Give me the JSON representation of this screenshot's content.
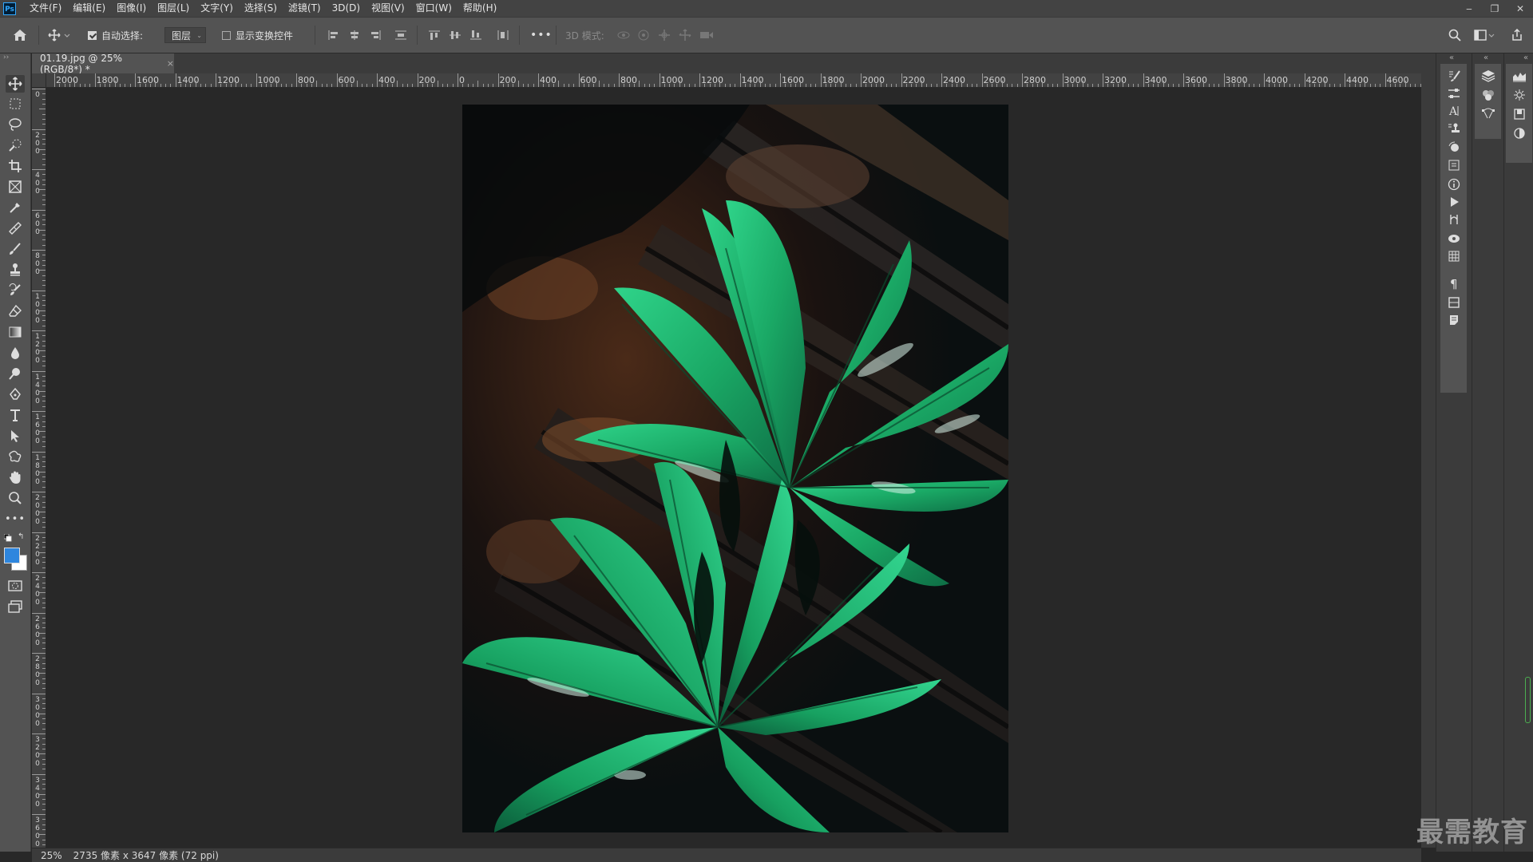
{
  "app": {
    "logo_text": "Ps"
  },
  "menu": {
    "items": [
      "文件(F)",
      "编辑(E)",
      "图像(I)",
      "图层(L)",
      "文字(Y)",
      "选择(S)",
      "滤镜(T)",
      "3D(D)",
      "视图(V)",
      "窗口(W)",
      "帮助(H)"
    ]
  },
  "window_controls": {
    "minimize": "‒",
    "restore": "❐",
    "close": "✕"
  },
  "options_bar": {
    "auto_select_label": "自动选择:",
    "auto_select_checked": true,
    "layer_select_value": "图层",
    "show_transform_label": "显示变换控件",
    "show_transform_checked": false,
    "more": "•••",
    "mode_3d_label": "3D 模式:"
  },
  "document": {
    "tab_title": "01.19.jpg @ 25%(RGB/8*) *",
    "tab_close": "×"
  },
  "rulers": {
    "top_labels": [
      "2000",
      "1800",
      "1600",
      "1400",
      "1200",
      "1000",
      "800",
      "600",
      "400",
      "200",
      "0",
      "200",
      "400",
      "600",
      "800",
      "1000",
      "1200",
      "1400",
      "1600",
      "1800",
      "2000",
      "2200",
      "2400",
      "2600",
      "2800",
      "3000",
      "3200",
      "3400",
      "3600",
      "3800",
      "4000",
      "4200",
      "4400",
      "4600"
    ],
    "left_labels": [
      "0",
      "2 0 0",
      "4 0 0",
      "6 0 0",
      "8 0 0",
      "1 0 0 0",
      "1 2 0 0",
      "1 4 0 0",
      "1 6 0 0",
      "1 8 0 0",
      "2 0 0 0",
      "2 2 0 0",
      "2 4 0 0",
      "2 6 0 0",
      "2 8 0 0",
      "3 0 0 0",
      "3 2 0 0",
      "3 4 0 0",
      "3 6 0 0"
    ]
  },
  "status": {
    "zoom": "25%",
    "doc_info": "2735 像素 x 3647 像素 (72 ppi)"
  },
  "watermark": {
    "text": "最需教育"
  },
  "colors": {
    "foreground": "#2e86de",
    "background": "#ffffff",
    "leaf": "#1faa6a"
  }
}
